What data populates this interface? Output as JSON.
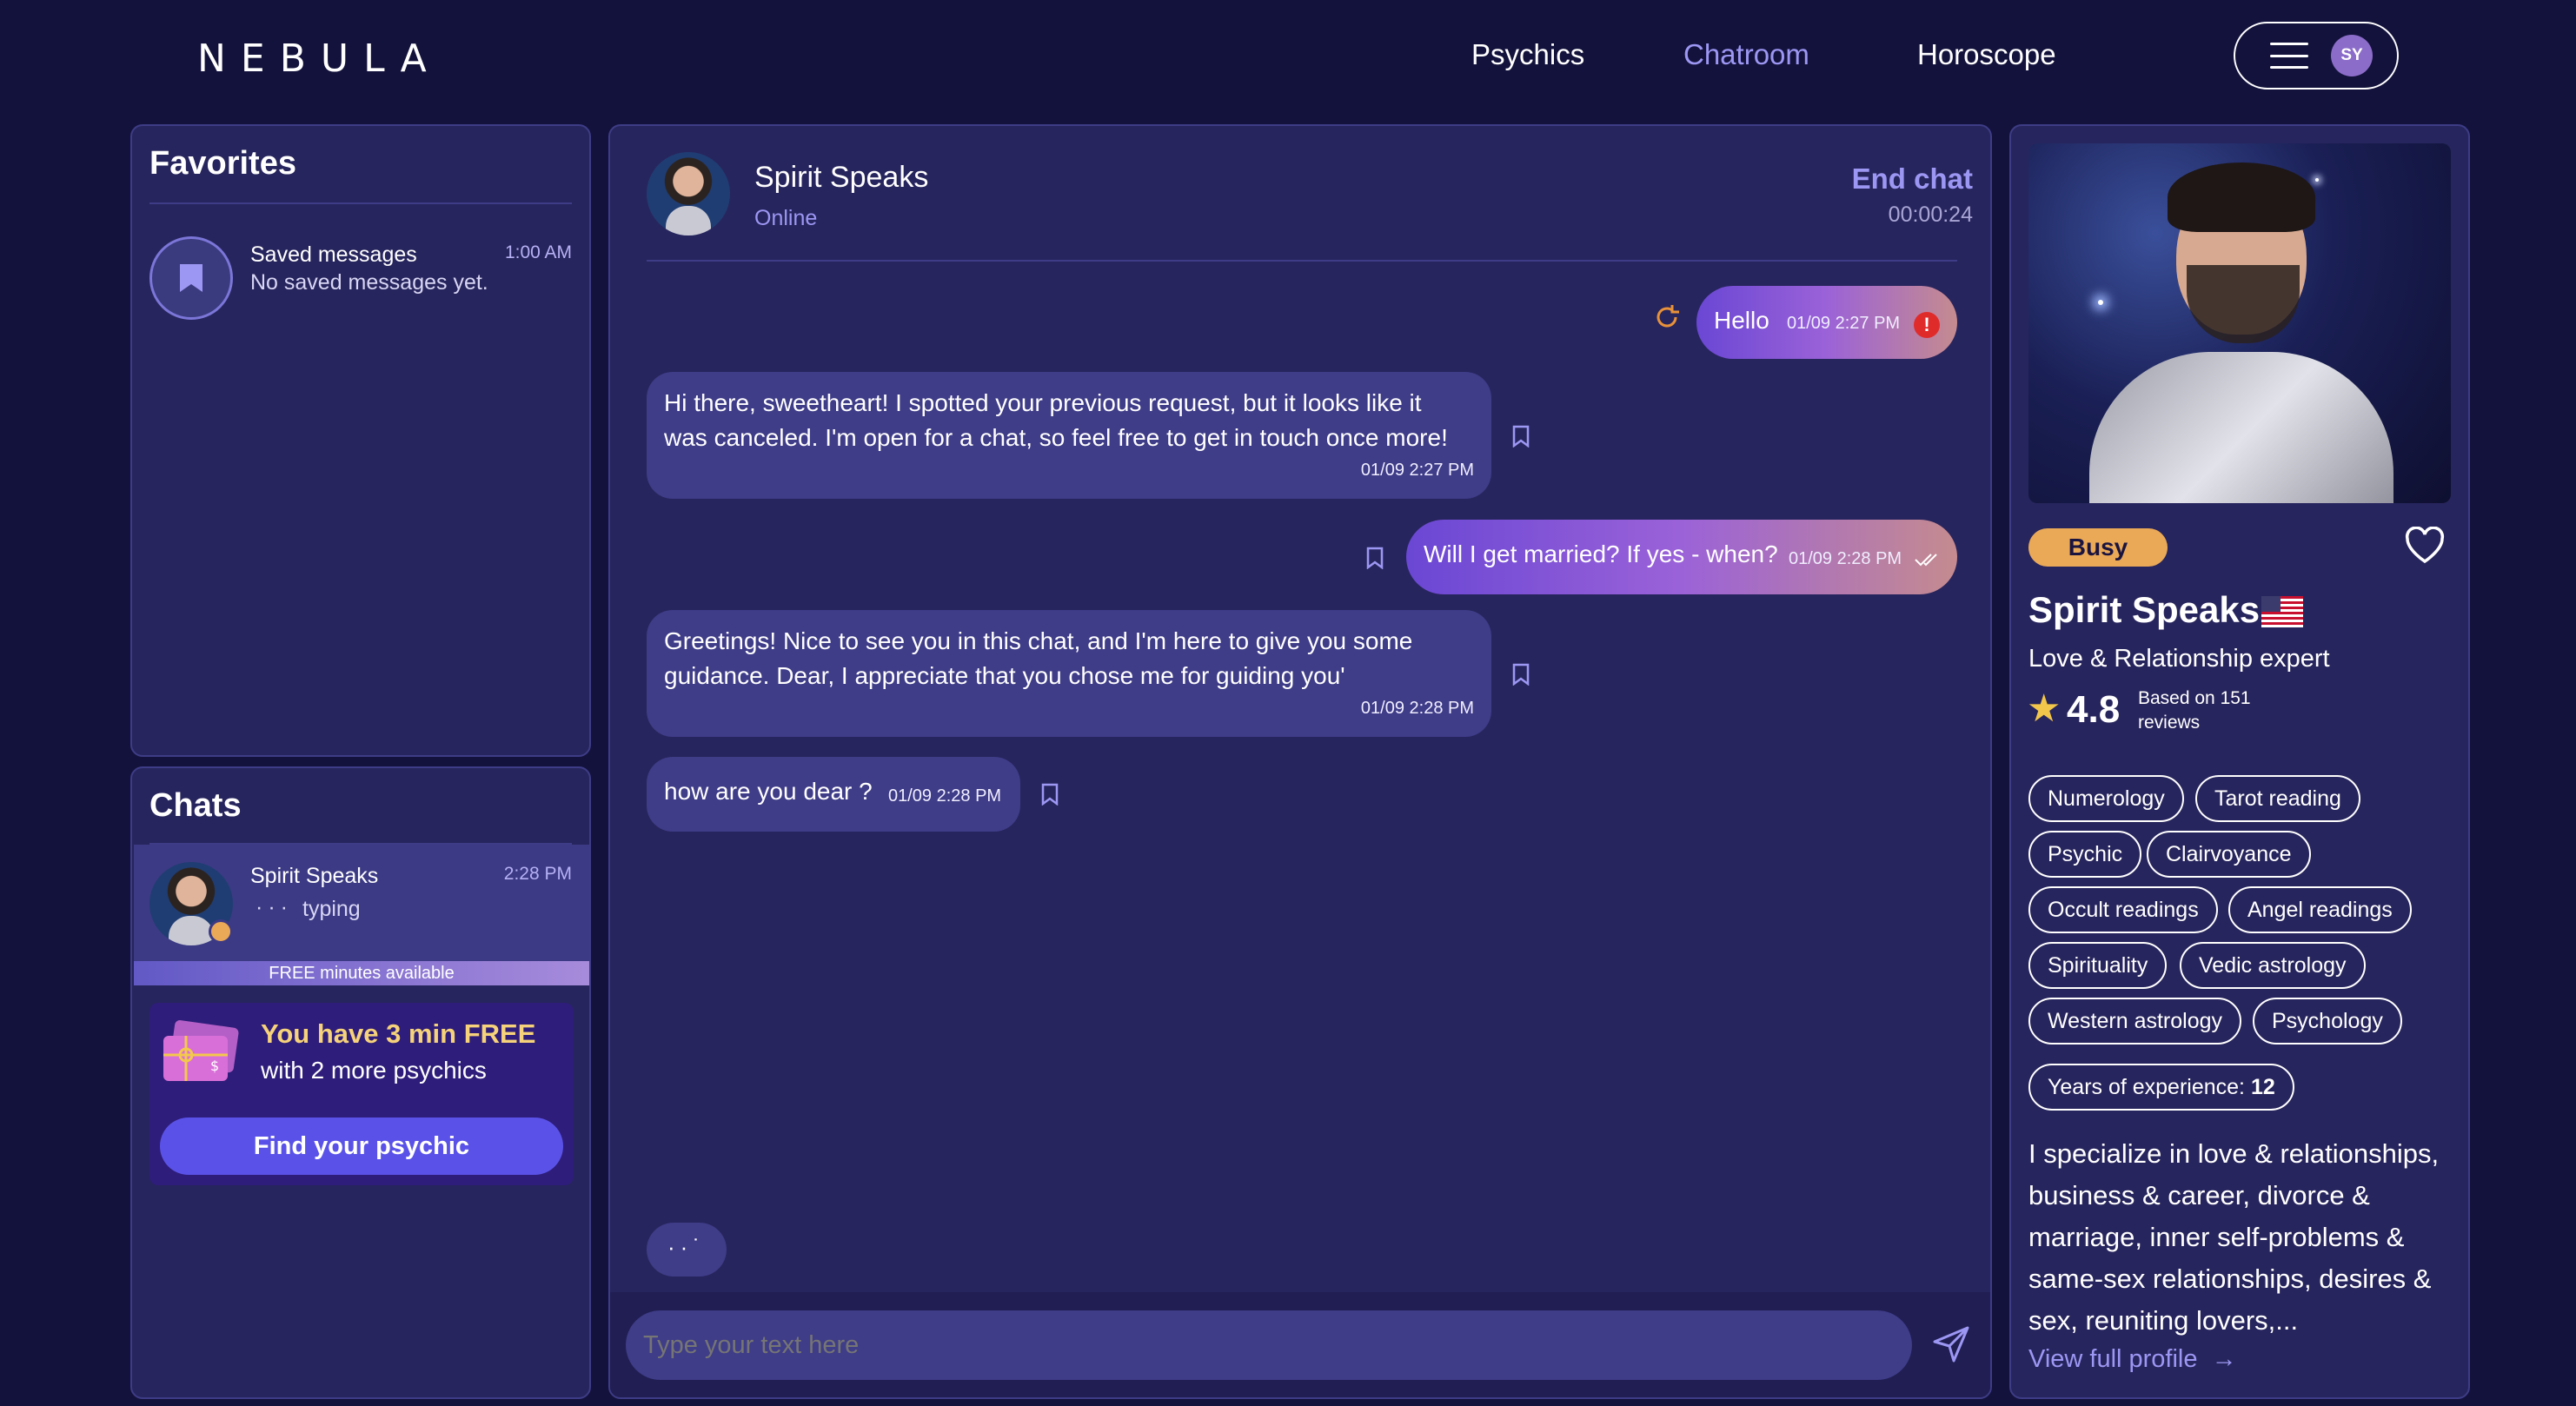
{
  "header": {
    "logo": "NEBULA",
    "nav": [
      "Psychics",
      "Chatroom",
      "Horoscope"
    ],
    "active_nav": "Chatroom",
    "user_initials": "SY"
  },
  "favorites": {
    "title": "Favorites",
    "item": {
      "title": "Saved messages",
      "subtitle": "No saved messages yet.",
      "time": "1:00 AM"
    }
  },
  "chats": {
    "title": "Chats",
    "item": {
      "name": "Spirit Speaks",
      "status": "typing",
      "time": "2:28 PM"
    },
    "free_bar": "FREE minutes available",
    "promo": {
      "line1": "You have 3 min FREE",
      "line2": "with 2 more psychics",
      "button": "Find your psychic"
    }
  },
  "conversation": {
    "name": "Spirit Speaks",
    "status": "Online",
    "end_chat": "End chat",
    "timer": "00:00:24",
    "messages": [
      {
        "dir": "out",
        "lines": [
          "Hello"
        ],
        "time": "01/09 2:27 PM",
        "state": "error"
      },
      {
        "dir": "in",
        "lines": [
          "Hi there, sweetheart! I spotted your previous request, but it looks like it",
          "was canceled. I'm open for a chat, so feel free to get in touch once more!"
        ],
        "time": "01/09 2:27 PM"
      },
      {
        "dir": "out",
        "lines": [
          "Will I get married? If yes - when?"
        ],
        "time": "01/09 2:28 PM",
        "state": "read"
      },
      {
        "dir": "in",
        "lines": [
          "Greetings! Nice to see you in this chat, and I'm here to give you some",
          "guidance. Dear, I appreciate that you chose me for guiding you'"
        ],
        "time": "01/09 2:28 PM"
      },
      {
        "dir": "in",
        "lines": [
          "how are you dear ?"
        ],
        "time": "01/09 2:28 PM"
      }
    ],
    "input_placeholder": "Type your text here"
  },
  "profile": {
    "status": "Busy",
    "name": "Spirit Speaks",
    "specialty": "Love & Relationship expert",
    "rating": "4.8",
    "reviews": [
      "Based on 151",
      "reviews"
    ],
    "tags": [
      "Numerology",
      "Tarot reading",
      "Psychic",
      "Clairvoyance",
      "Occult readings",
      "Angel readings",
      "Spirituality",
      "Vedic astrology",
      "Western astrology",
      "Psychology"
    ],
    "experience_label": "Years of experience: ",
    "experience_value": "12",
    "bio": [
      "I specialize in love & relationships,",
      "business & career, divorce &",
      "marriage, inner self-problems &",
      "same-sex relationships, desires &",
      "sex, reuniting lovers,..."
    ],
    "view_profile": "View full profile"
  },
  "colors": {
    "background": "#13123c",
    "panel": "#27255d",
    "accent": "#9d97f4",
    "busy": "#eaa957",
    "button": "#5a52e8"
  }
}
